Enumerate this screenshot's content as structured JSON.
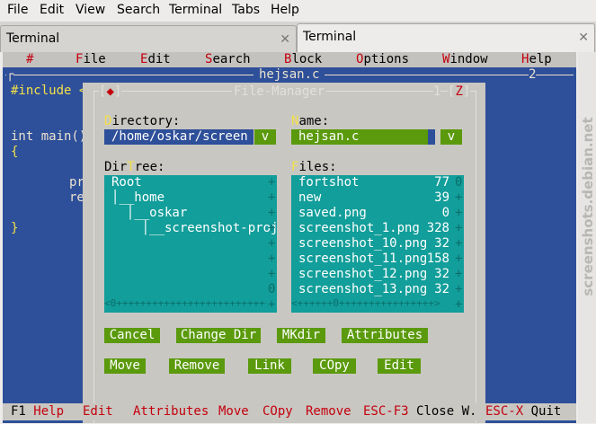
{
  "gtk_menu": [
    "File",
    "Edit",
    "View",
    "Search",
    "Terminal",
    "Tabs",
    "Help"
  ],
  "tabs": [
    {
      "label": "Terminal",
      "close": "✕",
      "active": false
    },
    {
      "label": "Terminal",
      "close": "✕",
      "active": true
    }
  ],
  "mc_menu": [
    {
      "label": "#",
      "hot": "#",
      "rest": ""
    },
    {
      "label": "File",
      "hot": "F",
      "rest": "ile"
    },
    {
      "label": "Edit",
      "hot": "E",
      "rest": "dit"
    },
    {
      "label": "Search",
      "hot": "S",
      "rest": "earch"
    },
    {
      "label": "Block",
      "hot": "B",
      "rest": "lock"
    },
    {
      "label": "Options",
      "hot": "O",
      "rest": "ptions"
    },
    {
      "label": "Window",
      "hot": "W",
      "rest": "indow"
    },
    {
      "label": "Help",
      "hot": "H",
      "rest": "elp"
    }
  ],
  "editor": {
    "frame_left": "┌",
    "title": "hejsan.c",
    "window_number": "2",
    "lines": [
      "#include <",
      "int main()",
      "{",
      "pr",
      "re",
      "}"
    ]
  },
  "dialog": {
    "title": "File-Manager",
    "close_glyph": "◆",
    "number": "1",
    "zoom": "Z",
    "directory_label": {
      "hot": "D",
      "rest": "irectory:"
    },
    "directory_value": "/home/oskar/screen",
    "directory_button": "v",
    "name_label": {
      "hot": "N",
      "rest": "ame:"
    },
    "name_value": "hejsan.c",
    "name_button": "v",
    "dirtree_label": {
      "pre": "Dir",
      "hot": "T",
      "rest": "ree:"
    },
    "dirtree": [
      "Root",
      "│__home",
      "  │__oskar",
      "    │__screenshot-proj"
    ],
    "files_label": {
      "hot": "F",
      "rest": "iles:"
    },
    "files": [
      {
        "name": "fortshot",
        "size": "77"
      },
      {
        "name": "new",
        "size": "39"
      },
      {
        "name": "saved.png",
        "size": "0"
      },
      {
        "name": "screenshot_1.png",
        "size": "328"
      },
      {
        "name": "screenshot_10.png",
        "size": "32"
      },
      {
        "name": "screenshot_11.png",
        "size": "158"
      },
      {
        "name": "screenshot_12.png",
        "size": "32"
      },
      {
        "name": "screenshot_13.png",
        "size": "32"
      }
    ],
    "left_vscroll": [
      "+",
      "+",
      "+",
      "+",
      "+",
      "+",
      "+",
      "0",
      "+"
    ],
    "right_vscroll": [
      "0",
      "+",
      "+",
      "+",
      "+",
      "+",
      "+",
      "+",
      "+"
    ],
    "left_hscroll": "<0+++++++++++++++++++++++++++++++++++>",
    "right_hscroll": "<++++++0++++++++++++++++>",
    "buttons_row1": [
      "Cancel",
      "Change Dir",
      "MKdir",
      "Attributes"
    ],
    "buttons_row2": [
      "Move",
      "Remove",
      "Link",
      "COpy",
      "Edit"
    ]
  },
  "keybar": [
    {
      "key": "F1",
      "label": "Help"
    },
    {
      "key": "",
      "label": "Edit"
    },
    {
      "key": "",
      "label": "Attributes"
    },
    {
      "key": "",
      "label": "Move"
    },
    {
      "key": "",
      "label": "COpy"
    },
    {
      "key": "",
      "label": "Remove"
    },
    {
      "key": "ESC-F3",
      "label": "Close W."
    },
    {
      "key": "ESC-X",
      "label": "Quit"
    }
  ],
  "watermark": "screenshots.debian.net"
}
